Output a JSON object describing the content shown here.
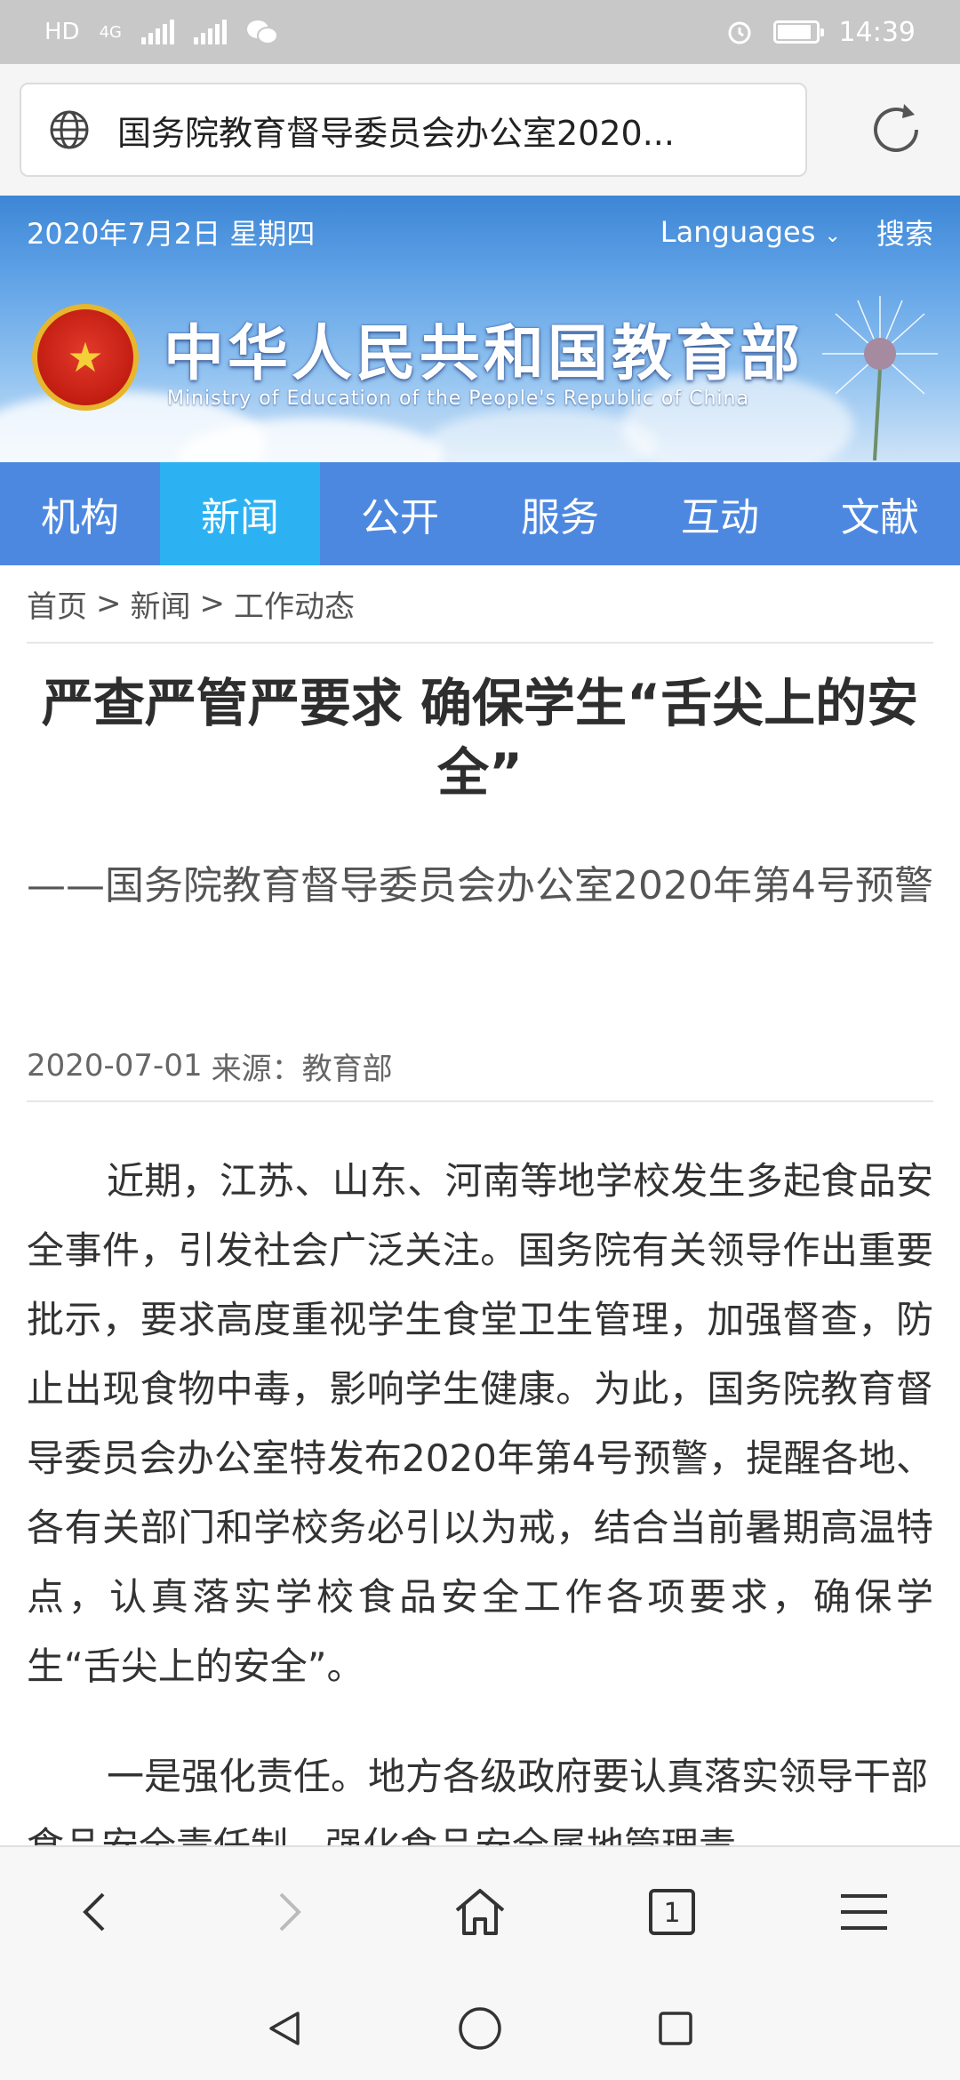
{
  "status_bar": {
    "left_text": "HD",
    "network": "4G",
    "time": "14:39"
  },
  "browser": {
    "url_title": "国务院教育督导委员会办公室2020...",
    "icons": [
      "globe-icon",
      "reload-icon"
    ]
  },
  "site": {
    "date": "2020年7月2日 星期四",
    "languages": "Languages",
    "languages_arrow": "⌄",
    "search": "搜索",
    "title": "中华人民共和国教育部",
    "subtitle": "Ministry of Education of the People's Republic of China"
  },
  "nav": {
    "items": [
      {
        "label": "机构",
        "active": false
      },
      {
        "label": "新闻",
        "active": true
      },
      {
        "label": "公开",
        "active": false
      },
      {
        "label": "服务",
        "active": false
      },
      {
        "label": "互动",
        "active": false
      },
      {
        "label": "文献",
        "active": false
      }
    ]
  },
  "breadcrumb": {
    "home": "首页",
    "sep1": ">",
    "news": "新闻",
    "sep2": ">",
    "current": "工作动态"
  },
  "article": {
    "title": "严查严管严要求 确保学生“舌尖上的安全”",
    "subtitle": "——国务院教育督导委员会办公室2020年第4号预警",
    "date": "2020-07-01",
    "source": "来源：教育部",
    "paragraph1": "近期，江苏、山东、河南等地学校发生多起食品安全事件，引发社会广泛关注。国务院有关领导作出重要批示，要求高度重视学生食堂卫生管理，加强督查，防止出现食物中毒，影响学生健康。为此，国务院教育督导委员会办公室特发布2020年第4号预警，提醒各地、各有关部门和学校务必引以为戒，结合当前暑期高温特点，认真落实学校食品安全工作各项要求，确保学生“舌尖上的安全”。",
    "paragraph2": "一是强化责任。地方各级政府要认真落实领导干部食品安全责任制，强化食品安全属地管理责"
  },
  "toolbar": {
    "tab_count": "1",
    "icons": [
      "back-icon",
      "forward-icon",
      "home-icon",
      "tabs-icon",
      "menu-icon"
    ]
  },
  "colors": {
    "nav_bg": "#4d88e0",
    "nav_active": "#2cb2f3",
    "status_bar": "#c8c8c8"
  }
}
